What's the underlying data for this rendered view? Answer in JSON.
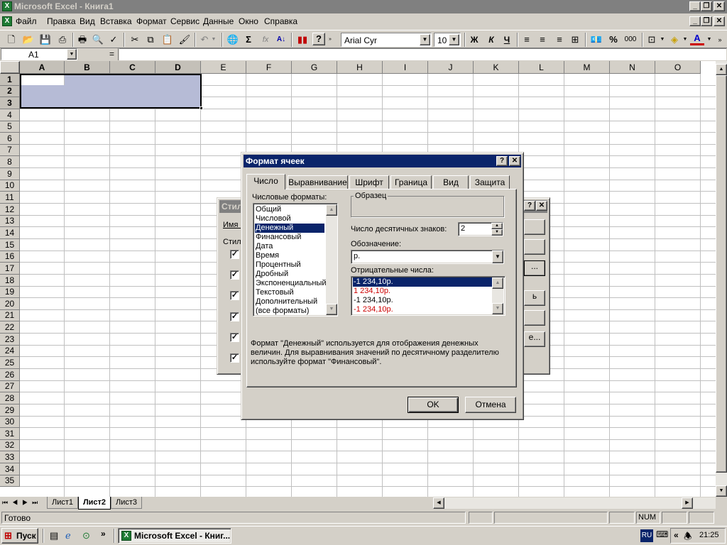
{
  "window": {
    "title": "Microsoft Excel - Книга1",
    "app_icon": "excel-icon",
    "controls": [
      "minimize",
      "restore",
      "close"
    ]
  },
  "menu": [
    "Файл",
    "Правка",
    "Вид",
    "Вставка",
    "Формат",
    "Сервис",
    "Данные",
    "Окно",
    "Справка"
  ],
  "toolbar": {
    "font_name": "Arial Cyr",
    "font_size": "10",
    "bold_label": "Ж",
    "italic_label": "К",
    "underline_label": "Ч",
    "percent_label": "%",
    "thousands_label": "000",
    "sum_label": "Σ",
    "fx_label": "fx"
  },
  "formula_bar": {
    "name_box": "A1",
    "equals": "=",
    "formula": ""
  },
  "grid": {
    "columns": [
      "A",
      "B",
      "C",
      "D",
      "E",
      "F",
      "G",
      "H",
      "I",
      "J",
      "K",
      "L",
      "M",
      "N",
      "O"
    ],
    "rows": [
      "1",
      "2",
      "3",
      "4",
      "5",
      "6",
      "7",
      "8",
      "9",
      "10",
      "11",
      "12",
      "13",
      "14",
      "15",
      "16",
      "17",
      "18",
      "19",
      "20",
      "21",
      "22",
      "23",
      "24",
      "25",
      "26",
      "27",
      "28",
      "29",
      "30",
      "31",
      "32",
      "33",
      "34",
      "35"
    ],
    "selection": "A1:D3"
  },
  "style_dialog_behind": {
    "title": "Стил",
    "name_label": "Имя с",
    "includes_label": "Стил",
    "checkbox_states": [
      true,
      true,
      true,
      true,
      true,
      true
    ],
    "button_fragments": [
      "",
      "",
      "...",
      "ь",
      "",
      "е..."
    ]
  },
  "format_dialog": {
    "title": "Формат ячеек",
    "help_btn": "?",
    "close_btn": "✕",
    "tabs": [
      "Число",
      "Выравнивание",
      "Шрифт",
      "Граница",
      "Вид",
      "Защита"
    ],
    "active_tab": "Число",
    "formats_label": "Числовые форматы:",
    "formats": [
      "Общий",
      "Числовой",
      "Денежный",
      "Финансовый",
      "Дата",
      "Время",
      "Процентный",
      "Дробный",
      "Экспоненциальный",
      "Текстовый",
      "Дополнительный",
      "(все форматы)"
    ],
    "selected_format": "Денежный",
    "sample_label": "Образец",
    "decimals_label": "Число десятичных знаков:",
    "decimals_value": "2",
    "symbol_label": "Обозначение:",
    "symbol_value": "р.",
    "negative_label": "Отрицательные числа:",
    "negative_options": [
      "-1 234,10р.",
      "1 234,10р.",
      "-1 234,10р.",
      "-1 234,10р."
    ],
    "negative_colors": [
      "#ffffff",
      "#cc0000",
      "#000000",
      "#cc0000"
    ],
    "description": "Формат \"Денежный\" используется для отображения денежных величин. Для выравнивания значений по десятичному разделителю используйте формат \"Финансовый\".",
    "ok_label": "OK",
    "cancel_label": "Отмена"
  },
  "sheets": [
    "Лист1",
    "Лист2",
    "Лист3"
  ],
  "active_sheet": "Лист2",
  "status": {
    "ready": "Готово",
    "num": "NUM"
  },
  "taskbar": {
    "start_label": "Пуск",
    "task_label": "Microsoft Excel - Книг...",
    "lang": "RU",
    "clock": "21:25",
    "chevron": "»"
  },
  "colors": {
    "title_inactive": "#808080",
    "title_active": "#0a246a",
    "selection": "#b6bbd6",
    "highlight": "#0a246a"
  }
}
